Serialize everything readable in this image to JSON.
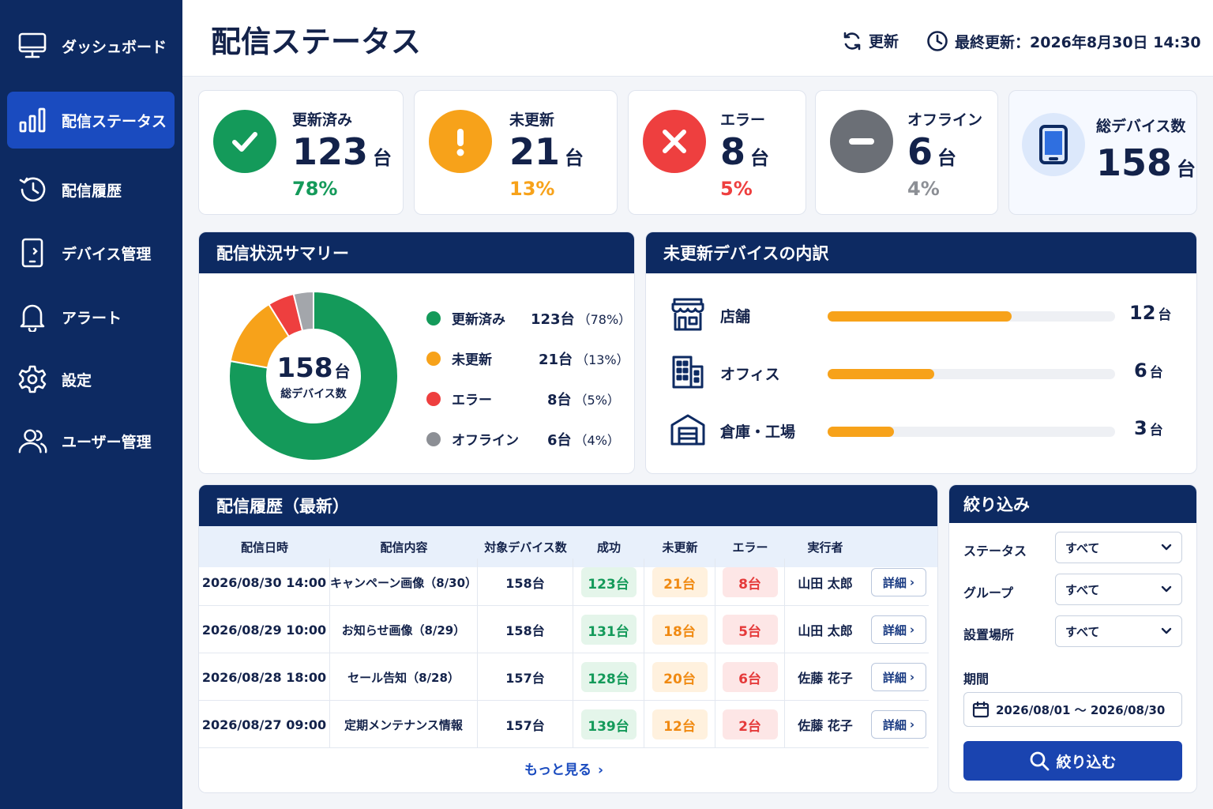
{
  "sidebar": {
    "items": [
      {
        "label": "ダッシュボード",
        "icon": "monitor-icon"
      },
      {
        "label": "配信ステータス",
        "icon": "bar-chart-icon",
        "active": true
      },
      {
        "label": "配信履歴",
        "icon": "history-icon"
      },
      {
        "label": "デバイス管理",
        "icon": "tablet-icon"
      },
      {
        "label": "アラート",
        "icon": "bell-icon"
      },
      {
        "label": "設定",
        "icon": "gear-icon"
      },
      {
        "label": "ユーザー管理",
        "icon": "users-icon"
      }
    ]
  },
  "header": {
    "title": "配信ステータス",
    "refresh_label": "更新",
    "last_updated": "最終更新：2026年8月30日 14:30"
  },
  "stats": [
    {
      "label": "更新済み",
      "value": "123",
      "unit": "台",
      "pct": "78%",
      "color": "#149a5a",
      "icon": "check-icon"
    },
    {
      "label": "未更新",
      "value": "21",
      "unit": "台",
      "pct": "13%",
      "color": "#f7a21a",
      "icon": "exclamation-icon"
    },
    {
      "label": "エラー",
      "value": "8",
      "unit": "台",
      "pct": "5%",
      "color": "#ee3f3f",
      "icon": "x-icon"
    },
    {
      "label": "オフライン",
      "value": "6",
      "unit": "台",
      "pct": "4%",
      "color": "#6b6f76",
      "icon": "minus-icon"
    },
    {
      "label": "総デバイス数",
      "value": "158",
      "unit": "台",
      "icon": "tablet-icon"
    }
  ],
  "summary": {
    "title": "配信状況サマリー",
    "center_value": "158",
    "center_unit": "台",
    "center_label": "総デバイス数",
    "chart_data": {
      "type": "pie",
      "categories": [
        "更新済み",
        "未更新",
        "エラー",
        "オフライン"
      ],
      "values": [
        123,
        21,
        8,
        6
      ],
      "colors": [
        "#149a5a",
        "#f7a21a",
        "#ee3f3f",
        "#a3a6ab"
      ]
    },
    "legend": [
      {
        "name": "更新済み",
        "count": "123台",
        "pct": "（78%）",
        "color": "#149a5a"
      },
      {
        "name": "未更新",
        "count": "21台",
        "pct": "（13%）",
        "color": "#f7a21a"
      },
      {
        "name": "エラー",
        "count": "8台",
        "pct": "（5%）",
        "color": "#ee3f3f"
      },
      {
        "name": "オフライン",
        "count": "6台",
        "pct": "（4%）",
        "color": "#8c8f95"
      }
    ]
  },
  "breakdown": {
    "title": "未更新デバイスの内訳",
    "items": [
      {
        "name": "店舗",
        "value": 12,
        "unit": "台",
        "fill": 0.64,
        "icon": "store-icon"
      },
      {
        "name": "オフィス",
        "value": 6,
        "unit": "台",
        "fill": 0.37,
        "icon": "office-building-icon"
      },
      {
        "name": "倉庫・工場",
        "value": 3,
        "unit": "台",
        "fill": 0.23,
        "icon": "warehouse-icon"
      }
    ]
  },
  "history": {
    "title": "配信履歴（最新）",
    "columns": [
      "配信日時",
      "配信内容",
      "対象デバイス数",
      "成功",
      "未更新",
      "エラー",
      "実行者"
    ],
    "rows": [
      {
        "date": "2026/08/30 14:00",
        "content": "キャンペーン画像（8/30）",
        "target": "158台",
        "success": "123台",
        "pending": "21台",
        "error": "8台",
        "user": "山田 太郎",
        "detail": "詳細"
      },
      {
        "date": "2026/08/29 10:00",
        "content": "お知らせ画像（8/29）",
        "target": "158台",
        "success": "131台",
        "pending": "18台",
        "error": "5台",
        "user": "山田 太郎",
        "detail": "詳細"
      },
      {
        "date": "2026/08/28 18:00",
        "content": "セール告知（8/28）",
        "target": "157台",
        "success": "128台",
        "pending": "20台",
        "error": "6台",
        "user": "佐藤 花子",
        "detail": "詳細"
      },
      {
        "date": "2026/08/27 09:00",
        "content": "定期メンテナンス情報",
        "target": "157台",
        "success": "139台",
        "pending": "12台",
        "error": "2台",
        "user": "佐藤 花子",
        "detail": "詳細"
      }
    ],
    "more_label": "もっと見る"
  },
  "filter": {
    "title": "絞り込み",
    "fields": [
      {
        "label": "ステータス",
        "value": "すべて"
      },
      {
        "label": "グループ",
        "value": "すべて"
      },
      {
        "label": "設置場所",
        "value": "すべて"
      }
    ],
    "period_label": "期間",
    "period_value": "2026/08/01 ～ 2026/08/30",
    "button_label": "絞り込む"
  }
}
